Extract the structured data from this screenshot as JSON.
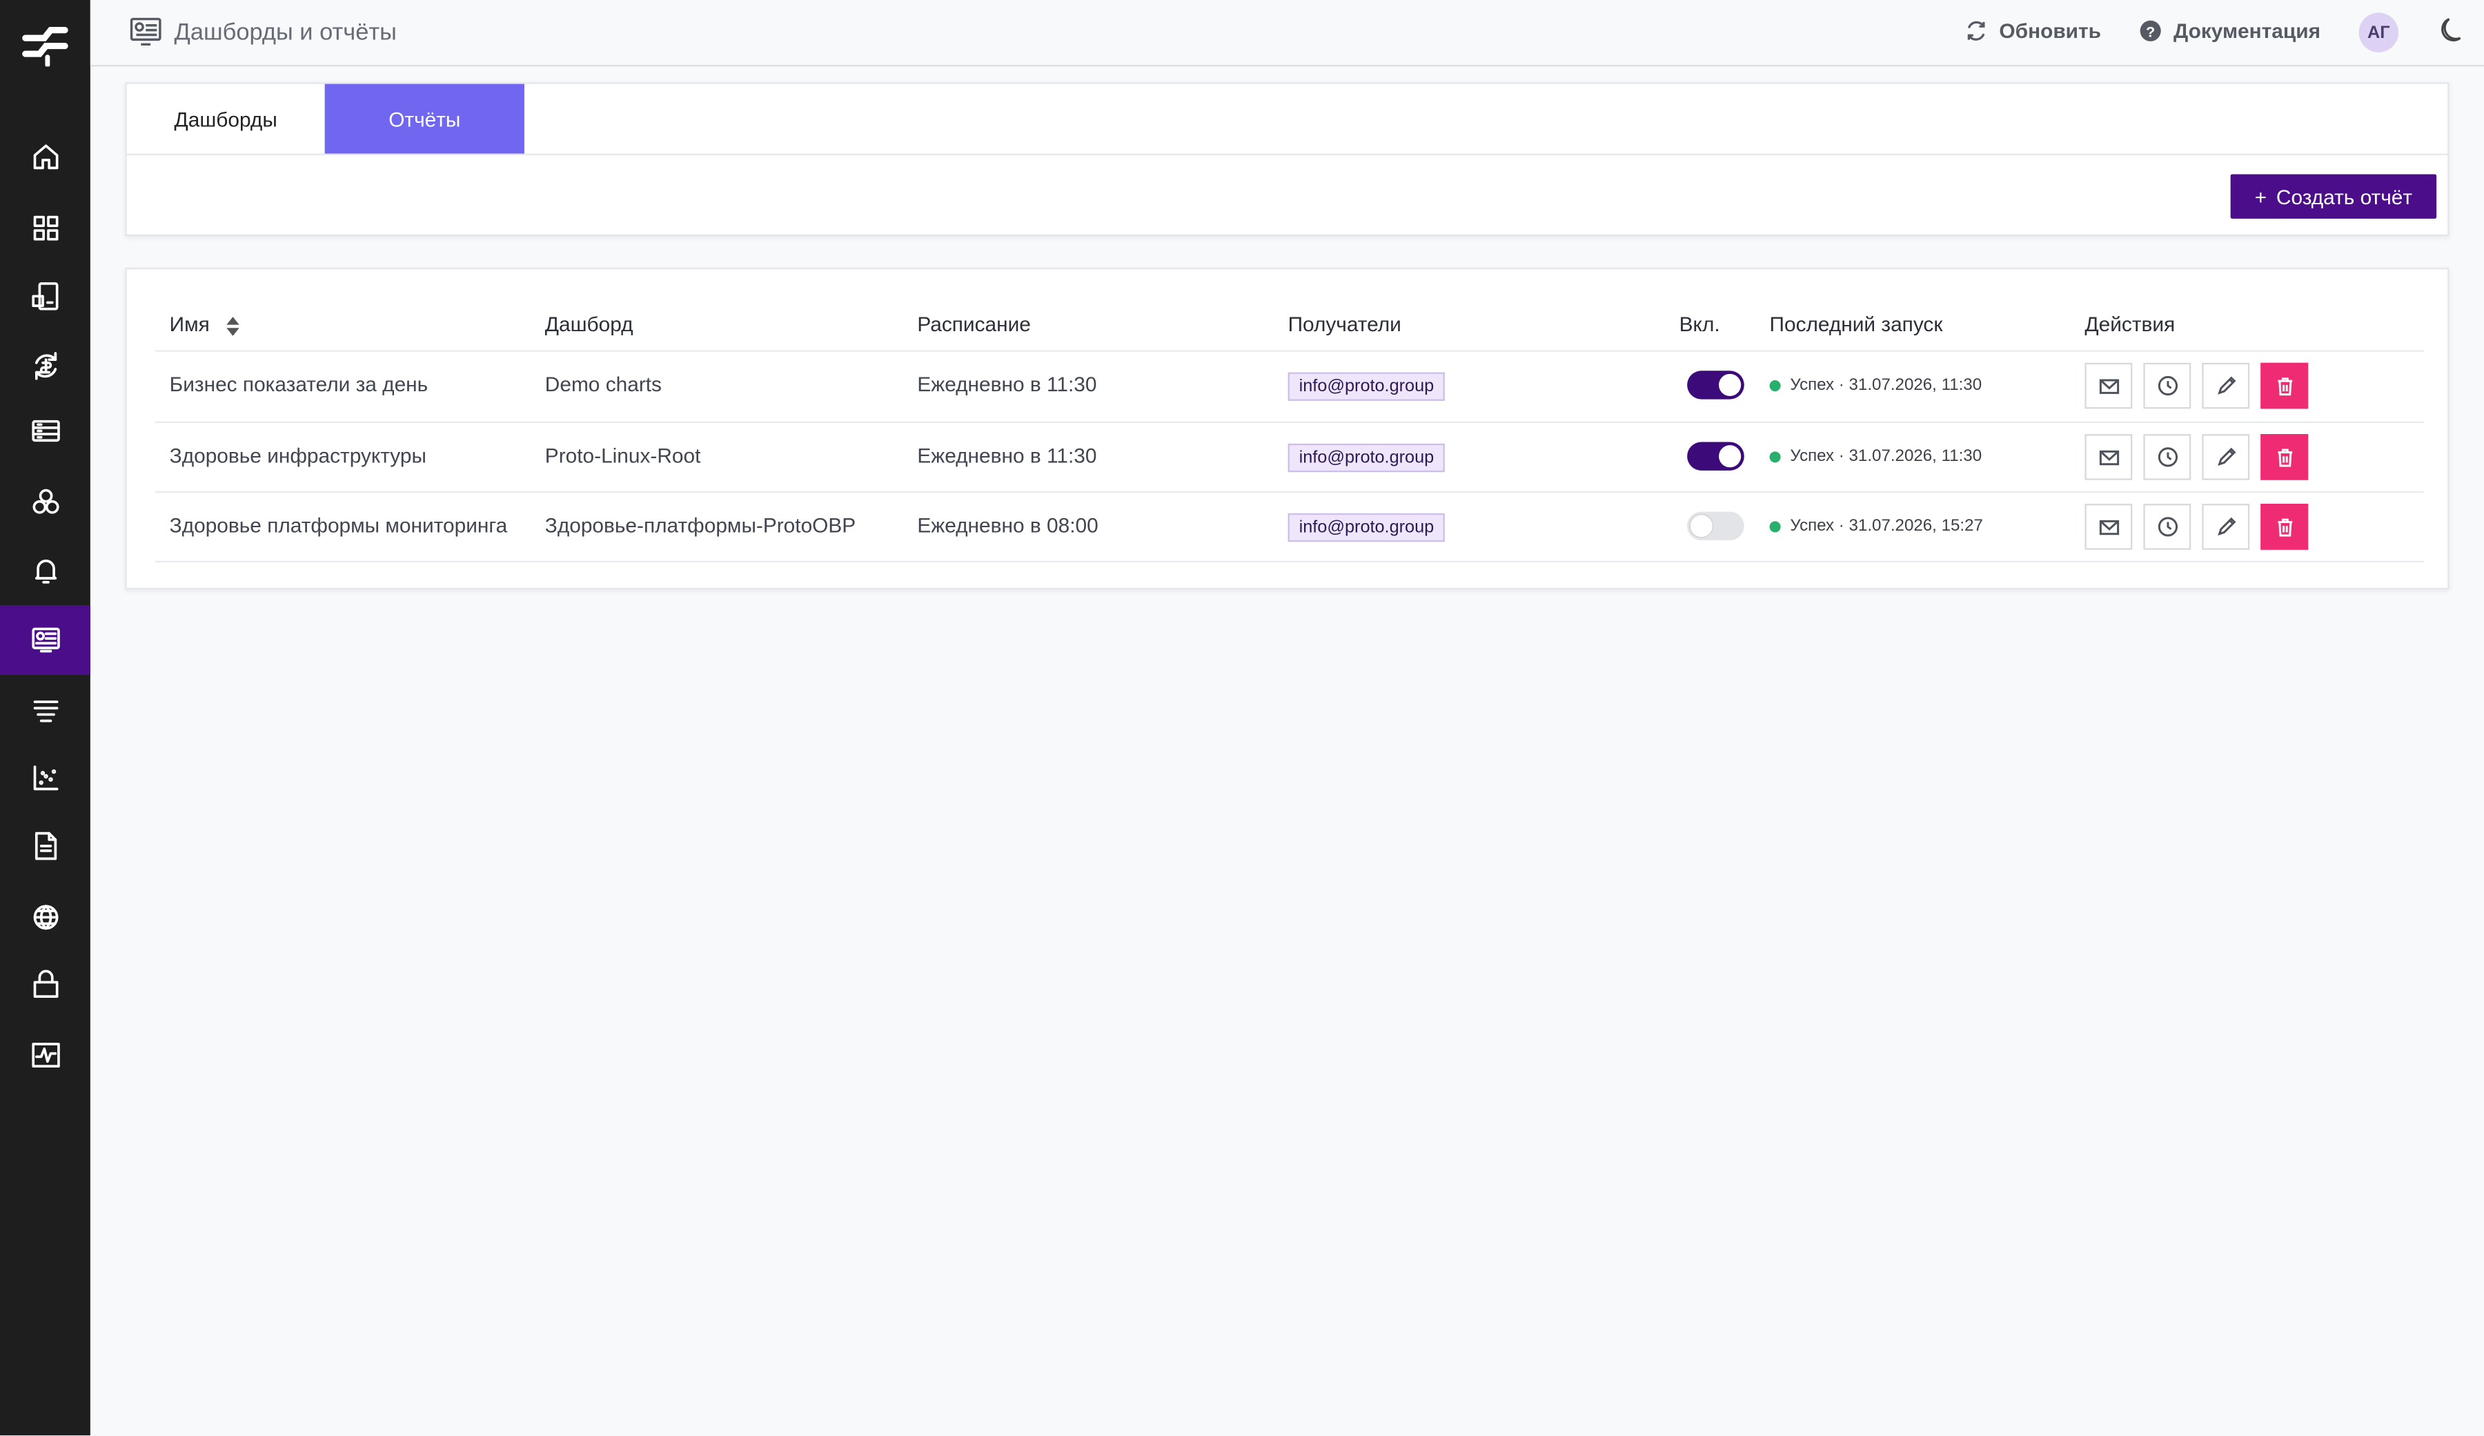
{
  "header": {
    "title": "Дашборды и отчёты",
    "refresh_label": "Обновить",
    "docs_label": "Документация",
    "avatar_initials": "АГ"
  },
  "tabs": [
    {
      "label": "Дашборды",
      "active": false
    },
    {
      "label": "Отчёты",
      "active": true
    }
  ],
  "create_button": {
    "label": "Создать отчёт"
  },
  "table": {
    "columns": {
      "name": "Имя",
      "dashboard": "Дашборд",
      "schedule": "Расписание",
      "recipients": "Получатели",
      "enabled": "Вкл.",
      "last_run": "Последний запуск",
      "actions": "Действия"
    },
    "rows": [
      {
        "name": "Бизнес показатели за день",
        "dashboard": "Demo charts",
        "schedule": "Ежедневно в 11:30",
        "recipients": "info@proto.group",
        "enabled": true,
        "last_run": "Успех · 31.07.2026, 11:30"
      },
      {
        "name": "Здоровье инфраструктуры",
        "dashboard": "Proto-Linux-Root",
        "schedule": "Ежедневно в 11:30",
        "recipients": "info@proto.group",
        "enabled": true,
        "last_run": "Успех · 31.07.2026, 11:30"
      },
      {
        "name": "Здоровье платформы мониторинга",
        "dashboard": "Здоровье-платформы-ProtoOBP",
        "schedule": "Ежедневно в 08:00",
        "recipients": "info@proto.group",
        "enabled": false,
        "last_run": "Успех · 31.07.2026, 15:27"
      }
    ]
  },
  "colors": {
    "sidebar": "#1e1e1f",
    "sidebar_active": "#4c0d8a",
    "tab_active": "#7166f0",
    "primary": "#4c0d8a",
    "toggle_on": "#3d0b79",
    "delete": "#ee2b73",
    "status_success": "#27b06c"
  },
  "sidebar_icons": [
    "home-icon",
    "grid-icon",
    "devices-icon",
    "sync-icon",
    "storage-icon",
    "cluster-icon",
    "bell-icon",
    "reports-icon",
    "layers-icon",
    "scatter-icon",
    "document-icon",
    "globe-icon",
    "lock-icon",
    "activity-icon"
  ]
}
